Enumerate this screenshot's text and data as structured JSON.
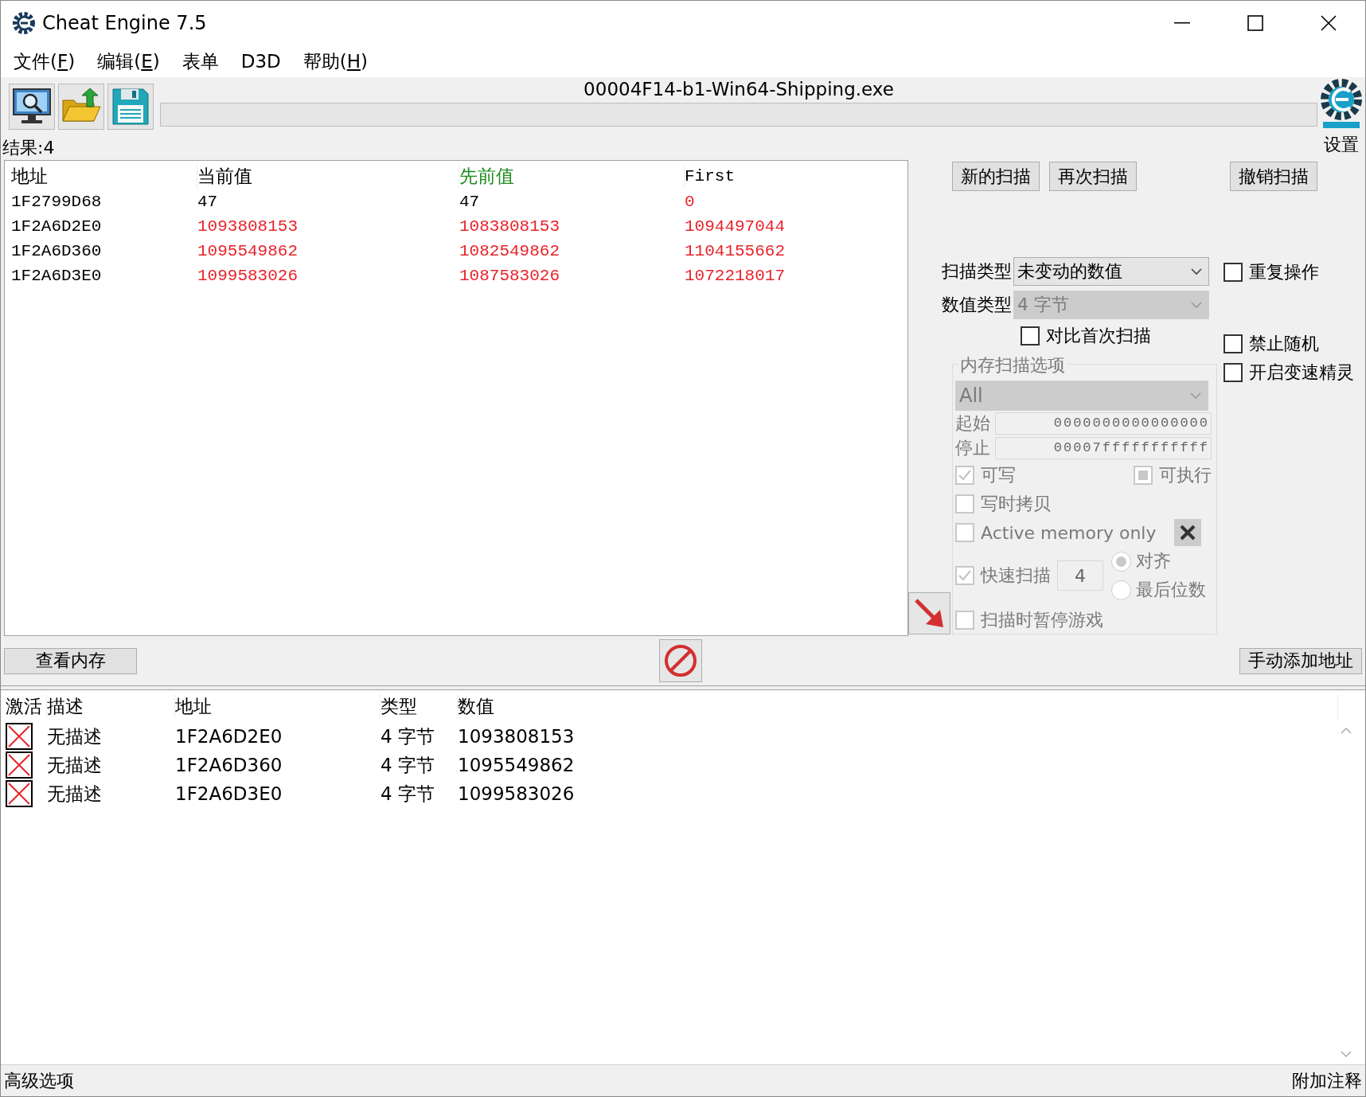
{
  "window": {
    "title": "Cheat Engine 7.5"
  },
  "menu": [
    {
      "text": "文件(",
      "key": "F",
      "tail": ")"
    },
    {
      "text": "编辑(",
      "key": "E",
      "tail": ")"
    },
    {
      "text": "表单"
    },
    {
      "text": "D3D"
    },
    {
      "text": "帮助(",
      "key": "H",
      "tail": ")"
    }
  ],
  "process_name": "00004F14-b1-Win64-Shipping.exe",
  "scan_progress": {
    "level": 0
  },
  "settings_label": "设置",
  "result_count": "结果:4",
  "results": {
    "columns": [
      {
        "label": "地址",
        "color": "#000000"
      },
      {
        "label": "当前值",
        "color": "#000000"
      },
      {
        "label": "先前值",
        "color": "#1e8c1e"
      },
      {
        "label": "First",
        "color": "#000000"
      }
    ],
    "rows": [
      {
        "cells": [
          {
            "text": "1F2799D68",
            "changed": false
          },
          {
            "text": "47",
            "changed": false
          },
          {
            "text": "47",
            "changed": false
          },
          {
            "text": "0",
            "changed": true
          }
        ]
      },
      {
        "cells": [
          {
            "text": "1F2A6D2E0",
            "changed": false
          },
          {
            "text": "1093808153",
            "changed": true
          },
          {
            "text": "1083808153",
            "changed": true
          },
          {
            "text": "1094497044",
            "changed": true
          }
        ]
      },
      {
        "cells": [
          {
            "text": "1F2A6D360",
            "changed": false
          },
          {
            "text": "1095549862",
            "changed": true
          },
          {
            "text": "1082549862",
            "changed": true
          },
          {
            "text": "1104155662",
            "changed": true
          }
        ]
      },
      {
        "cells": [
          {
            "text": "1F2A6D3E0",
            "changed": false
          },
          {
            "text": "1099583026",
            "changed": true
          },
          {
            "text": "1087583026",
            "changed": true
          },
          {
            "text": "1072218017",
            "changed": true
          }
        ]
      }
    ]
  },
  "scan_buttons": [
    "新的扫描",
    "再次扫描",
    "撤销扫描"
  ],
  "scan_type": {
    "label": "扫描类型",
    "value": "未变动的数值",
    "disabled": false
  },
  "value_type": {
    "label": "数值类型",
    "value": "4 字节",
    "disabled": true
  },
  "compare_first": {
    "label": "对比首次扫描",
    "checked": false
  },
  "side_options": [
    {
      "label": "重复操作",
      "checked": false
    },
    {
      "label": "禁止随机",
      "checked": false
    },
    {
      "label": "开启变速精灵",
      "checked": false
    }
  ],
  "memory_options": {
    "title": "内存扫描选项",
    "disabled": true,
    "region": {
      "value": "All"
    },
    "start": {
      "label": "起始",
      "value": "0000000000000000"
    },
    "stop": {
      "label": "停止",
      "value": "00007fffffffffff"
    },
    "writable": {
      "label": "可写",
      "checked": true
    },
    "executable": {
      "label": "可执行",
      "checked": false,
      "indeterminate": true
    },
    "copy_on_write": {
      "label": "写时拷贝",
      "checked": false
    },
    "active_memory_only": {
      "label": "Active memory only",
      "checked": false
    },
    "fast_scan": {
      "label": "快速扫描",
      "checked": true,
      "value": "4"
    },
    "alignment": [
      {
        "label": "对齐",
        "selected": true
      },
      {
        "label": "最后位数",
        "selected": false
      }
    ],
    "pause_game": {
      "label": "扫描时暂停游戏",
      "checked": false
    }
  },
  "memory_view_button": "查看内存",
  "add_address_button": "手动添加地址",
  "address_list": {
    "columns": [
      "激活",
      "描述",
      "地址",
      "类型",
      "数值"
    ],
    "rows": [
      {
        "active": false,
        "description": "无描述",
        "address": "1F2A6D2E0",
        "type": "4 字节",
        "value": "1093808153"
      },
      {
        "active": false,
        "description": "无描述",
        "address": "1F2A6D360",
        "type": "4 字节",
        "value": "1095549862"
      },
      {
        "active": false,
        "description": "无描述",
        "address": "1F2A6D3E0",
        "type": "4 字节",
        "value": "1099583026"
      }
    ]
  },
  "status_bar": {
    "left": "高级选项",
    "right": "附加注释"
  }
}
